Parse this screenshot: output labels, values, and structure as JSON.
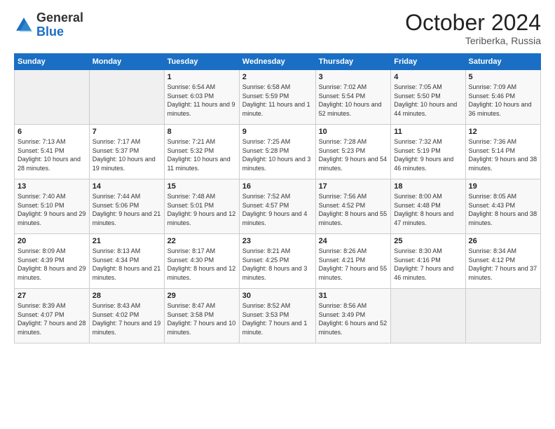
{
  "header": {
    "logo_general": "General",
    "logo_blue": "Blue",
    "month_title": "October 2024",
    "location": "Teriberka, Russia"
  },
  "days_of_week": [
    "Sunday",
    "Monday",
    "Tuesday",
    "Wednesday",
    "Thursday",
    "Friday",
    "Saturday"
  ],
  "weeks": [
    [
      {
        "num": "",
        "sunrise": "",
        "sunset": "",
        "daylight": "",
        "empty": true
      },
      {
        "num": "",
        "sunrise": "",
        "sunset": "",
        "daylight": "",
        "empty": true
      },
      {
        "num": "1",
        "sunrise": "Sunrise: 6:54 AM",
        "sunset": "Sunset: 6:03 PM",
        "daylight": "Daylight: 11 hours and 9 minutes."
      },
      {
        "num": "2",
        "sunrise": "Sunrise: 6:58 AM",
        "sunset": "Sunset: 5:59 PM",
        "daylight": "Daylight: 11 hours and 1 minute."
      },
      {
        "num": "3",
        "sunrise": "Sunrise: 7:02 AM",
        "sunset": "Sunset: 5:54 PM",
        "daylight": "Daylight: 10 hours and 52 minutes."
      },
      {
        "num": "4",
        "sunrise": "Sunrise: 7:05 AM",
        "sunset": "Sunset: 5:50 PM",
        "daylight": "Daylight: 10 hours and 44 minutes."
      },
      {
        "num": "5",
        "sunrise": "Sunrise: 7:09 AM",
        "sunset": "Sunset: 5:46 PM",
        "daylight": "Daylight: 10 hours and 36 minutes."
      }
    ],
    [
      {
        "num": "6",
        "sunrise": "Sunrise: 7:13 AM",
        "sunset": "Sunset: 5:41 PM",
        "daylight": "Daylight: 10 hours and 28 minutes."
      },
      {
        "num": "7",
        "sunrise": "Sunrise: 7:17 AM",
        "sunset": "Sunset: 5:37 PM",
        "daylight": "Daylight: 10 hours and 19 minutes."
      },
      {
        "num": "8",
        "sunrise": "Sunrise: 7:21 AM",
        "sunset": "Sunset: 5:32 PM",
        "daylight": "Daylight: 10 hours and 11 minutes."
      },
      {
        "num": "9",
        "sunrise": "Sunrise: 7:25 AM",
        "sunset": "Sunset: 5:28 PM",
        "daylight": "Daylight: 10 hours and 3 minutes."
      },
      {
        "num": "10",
        "sunrise": "Sunrise: 7:28 AM",
        "sunset": "Sunset: 5:23 PM",
        "daylight": "Daylight: 9 hours and 54 minutes."
      },
      {
        "num": "11",
        "sunrise": "Sunrise: 7:32 AM",
        "sunset": "Sunset: 5:19 PM",
        "daylight": "Daylight: 9 hours and 46 minutes."
      },
      {
        "num": "12",
        "sunrise": "Sunrise: 7:36 AM",
        "sunset": "Sunset: 5:14 PM",
        "daylight": "Daylight: 9 hours and 38 minutes."
      }
    ],
    [
      {
        "num": "13",
        "sunrise": "Sunrise: 7:40 AM",
        "sunset": "Sunset: 5:10 PM",
        "daylight": "Daylight: 9 hours and 29 minutes."
      },
      {
        "num": "14",
        "sunrise": "Sunrise: 7:44 AM",
        "sunset": "Sunset: 5:06 PM",
        "daylight": "Daylight: 9 hours and 21 minutes."
      },
      {
        "num": "15",
        "sunrise": "Sunrise: 7:48 AM",
        "sunset": "Sunset: 5:01 PM",
        "daylight": "Daylight: 9 hours and 12 minutes."
      },
      {
        "num": "16",
        "sunrise": "Sunrise: 7:52 AM",
        "sunset": "Sunset: 4:57 PM",
        "daylight": "Daylight: 9 hours and 4 minutes."
      },
      {
        "num": "17",
        "sunrise": "Sunrise: 7:56 AM",
        "sunset": "Sunset: 4:52 PM",
        "daylight": "Daylight: 8 hours and 55 minutes."
      },
      {
        "num": "18",
        "sunrise": "Sunrise: 8:00 AM",
        "sunset": "Sunset: 4:48 PM",
        "daylight": "Daylight: 8 hours and 47 minutes."
      },
      {
        "num": "19",
        "sunrise": "Sunrise: 8:05 AM",
        "sunset": "Sunset: 4:43 PM",
        "daylight": "Daylight: 8 hours and 38 minutes."
      }
    ],
    [
      {
        "num": "20",
        "sunrise": "Sunrise: 8:09 AM",
        "sunset": "Sunset: 4:39 PM",
        "daylight": "Daylight: 8 hours and 29 minutes."
      },
      {
        "num": "21",
        "sunrise": "Sunrise: 8:13 AM",
        "sunset": "Sunset: 4:34 PM",
        "daylight": "Daylight: 8 hours and 21 minutes."
      },
      {
        "num": "22",
        "sunrise": "Sunrise: 8:17 AM",
        "sunset": "Sunset: 4:30 PM",
        "daylight": "Daylight: 8 hours and 12 minutes."
      },
      {
        "num": "23",
        "sunrise": "Sunrise: 8:21 AM",
        "sunset": "Sunset: 4:25 PM",
        "daylight": "Daylight: 8 hours and 3 minutes."
      },
      {
        "num": "24",
        "sunrise": "Sunrise: 8:26 AM",
        "sunset": "Sunset: 4:21 PM",
        "daylight": "Daylight: 7 hours and 55 minutes."
      },
      {
        "num": "25",
        "sunrise": "Sunrise: 8:30 AM",
        "sunset": "Sunset: 4:16 PM",
        "daylight": "Daylight: 7 hours and 46 minutes."
      },
      {
        "num": "26",
        "sunrise": "Sunrise: 8:34 AM",
        "sunset": "Sunset: 4:12 PM",
        "daylight": "Daylight: 7 hours and 37 minutes."
      }
    ],
    [
      {
        "num": "27",
        "sunrise": "Sunrise: 8:39 AM",
        "sunset": "Sunset: 4:07 PM",
        "daylight": "Daylight: 7 hours and 28 minutes."
      },
      {
        "num": "28",
        "sunrise": "Sunrise: 8:43 AM",
        "sunset": "Sunset: 4:02 PM",
        "daylight": "Daylight: 7 hours and 19 minutes."
      },
      {
        "num": "29",
        "sunrise": "Sunrise: 8:47 AM",
        "sunset": "Sunset: 3:58 PM",
        "daylight": "Daylight: 7 hours and 10 minutes."
      },
      {
        "num": "30",
        "sunrise": "Sunrise: 8:52 AM",
        "sunset": "Sunset: 3:53 PM",
        "daylight": "Daylight: 7 hours and 1 minute."
      },
      {
        "num": "31",
        "sunrise": "Sunrise: 8:56 AM",
        "sunset": "Sunset: 3:49 PM",
        "daylight": "Daylight: 6 hours and 52 minutes."
      },
      {
        "num": "",
        "sunrise": "",
        "sunset": "",
        "daylight": "",
        "empty": true
      },
      {
        "num": "",
        "sunrise": "",
        "sunset": "",
        "daylight": "",
        "empty": true
      }
    ]
  ]
}
